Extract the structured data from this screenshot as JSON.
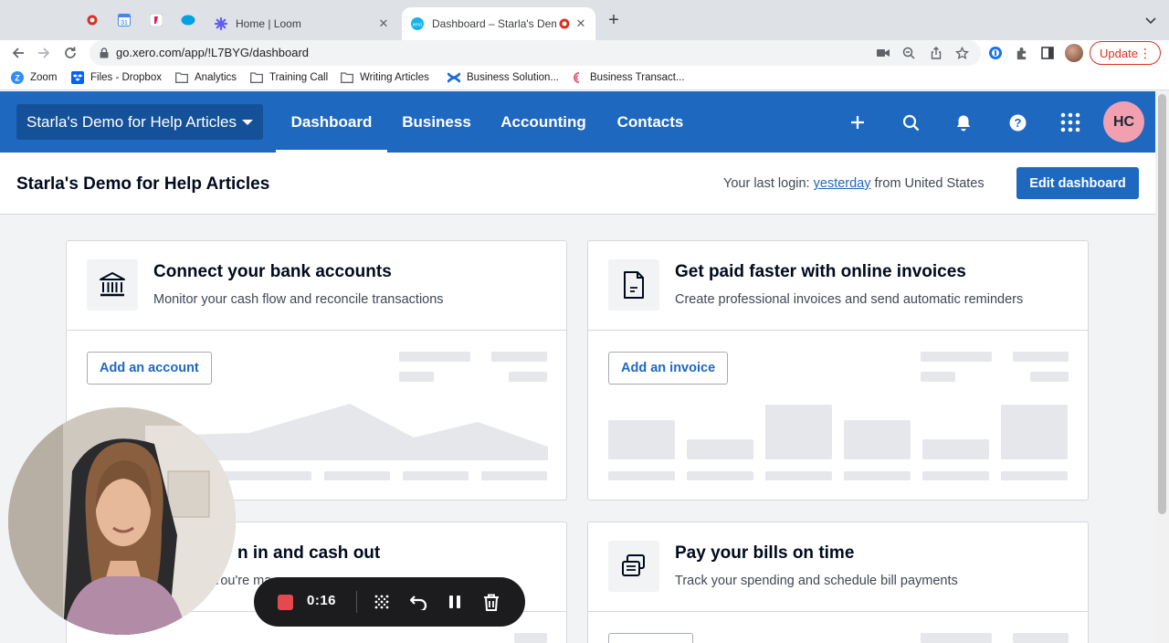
{
  "browser": {
    "tabs": [
      {
        "title": "Home | Loom",
        "icon": "loom-icon"
      },
      {
        "title": "Dashboard – Starla's Demo",
        "icon": "xero-icon",
        "active": true
      }
    ],
    "url": "go.xero.com/app/!L7BYG/dashboard",
    "update_label": "Update",
    "bookmarks": [
      {
        "label": "Zoom",
        "icon": "zoom-icon"
      },
      {
        "label": "Files - Dropbox",
        "icon": "dropbox-icon"
      },
      {
        "label": "Analytics",
        "icon": "folder-icon"
      },
      {
        "label": "Training Call",
        "icon": "folder-icon"
      },
      {
        "label": "Writing Articles",
        "icon": "folder-icon"
      },
      {
        "label": "Business Solution...",
        "icon": "confluence-icon"
      },
      {
        "label": "Business Transact...",
        "icon": "app-icon"
      }
    ]
  },
  "xero": {
    "org_name": "Starla's Demo for Help Articles",
    "nav": [
      "Dashboard",
      "Business",
      "Accounting",
      "Contacts"
    ],
    "active_nav": "Dashboard",
    "avatar_initials": "HC",
    "page_title": "Starla's Demo for Help Articles",
    "last_login_prefix": "Your last login:",
    "last_login_link": "yesterday",
    "last_login_suffix": "from United States",
    "edit_dashboard": "Edit dashboard",
    "cards": [
      {
        "title": "Connect your bank accounts",
        "subtitle": "Monitor your cash flow and reconcile transactions",
        "button": "Add an account",
        "icon": "bank-icon"
      },
      {
        "title": "Get paid faster with online invoices",
        "subtitle": "Create professional invoices and send automatic reminders",
        "button": "Add an invoice",
        "icon": "invoice-icon"
      },
      {
        "title": "n in and cash out",
        "subtitle": "You're ma",
        "icon": "cash-icon"
      },
      {
        "title": "Pay your bills on time",
        "subtitle": "Track your spending and schedule bill payments",
        "icon": "bills-icon"
      }
    ]
  },
  "loom": {
    "time": "0:16"
  },
  "colors": {
    "xero_blue": "#1f68c0",
    "org_box": "#155199",
    "avatar_pink": "#f2a0b0",
    "loom_red": "#e5484d"
  }
}
